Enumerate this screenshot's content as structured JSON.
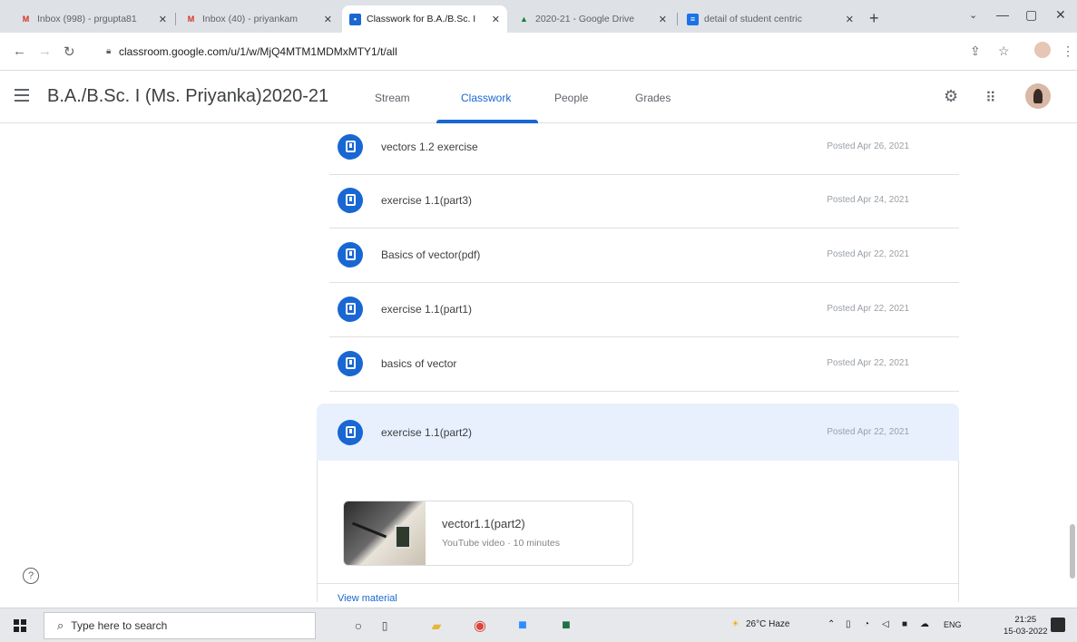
{
  "browser": {
    "tabs": [
      {
        "icon": "gmail-icon",
        "title": "Inbox (998) - prgupta81",
        "active": false
      },
      {
        "icon": "gmail-icon",
        "title": "Inbox (40) - priyankam",
        "active": false
      },
      {
        "icon": "classroom-icon",
        "title": "Classwork for B.A./B.Sc. I",
        "active": true
      },
      {
        "icon": "drive-icon",
        "title": "2020-21 - Google Drive",
        "active": false
      },
      {
        "icon": "sheets-icon",
        "title": "detail of student centric",
        "active": false
      }
    ],
    "url": "classroom.google.com/u/1/w/MjQ4MTM1MDMxMTY1/t/all"
  },
  "header": {
    "class_name": "B.A./B.Sc. I (Ms. Priyanka)2020-21",
    "tabs": [
      "Stream",
      "Classwork",
      "People",
      "Grades"
    ],
    "active_tab": "Classwork"
  },
  "classwork": {
    "items": [
      {
        "title": "vectors 1.2 exercise",
        "posted": "Posted Apr 26, 2021",
        "type_icon": "material-icon"
      },
      {
        "title": "exercise 1.1(part3)",
        "posted": "Posted Apr 24, 2021",
        "type_icon": "material-icon"
      },
      {
        "title": "Basics of vector(pdf)",
        "posted": "Posted Apr 22, 2021",
        "type_icon": "material-icon"
      },
      {
        "title": "exercise 1.1(part1)",
        "posted": "Posted Apr 22, 2021",
        "type_icon": "material-icon"
      },
      {
        "title": "basics of vector",
        "posted": "Posted Apr 22, 2021",
        "type_icon": "material-icon"
      },
      {
        "title": "exercise 1.1(part2)",
        "posted": "Posted Apr 22, 2021",
        "type_icon": "material-icon",
        "expanded": true
      }
    ],
    "attachment": {
      "title": "vector1.1(part2)",
      "subtitle": "YouTube video · 10 minutes"
    },
    "view_material": "View material"
  },
  "taskbar": {
    "search_placeholder": "Type here to search",
    "weather": "26°C Haze",
    "language": "ENG",
    "time": "21:25",
    "date": "15-03-2022"
  },
  "colors": {
    "accent": "#1967d2",
    "expanded_bg": "#e8f0fe"
  }
}
